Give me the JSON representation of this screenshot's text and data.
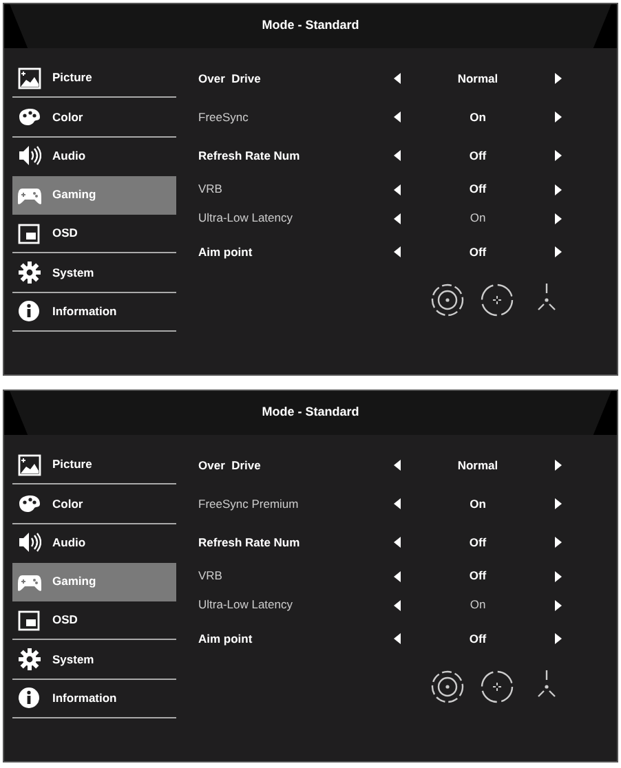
{
  "panels": [
    {
      "title": "Mode - Standard",
      "menu": [
        {
          "label": "Picture",
          "selected": false
        },
        {
          "label": "Color",
          "selected": false
        },
        {
          "label": "Audio",
          "selected": false
        },
        {
          "label": "Gaming",
          "selected": true
        },
        {
          "label": "OSD",
          "selected": false
        },
        {
          "label": "System",
          "selected": false
        },
        {
          "label": "Information",
          "selected": false
        }
      ],
      "settings": [
        {
          "label": "Over  Drive",
          "value": "Normal",
          "emphasized": true,
          "value_emphasized": true
        },
        {
          "label": "FreeSync",
          "value": "On",
          "emphasized": false,
          "value_emphasized": true
        },
        {
          "label": "Refresh Rate Num",
          "value": "Off",
          "emphasized": true,
          "value_emphasized": true
        },
        {
          "label": "VRB",
          "value": "Off",
          "emphasized": false,
          "value_emphasized": true
        },
        {
          "label": "Ultra-Low Latency",
          "value": "On",
          "emphasized": false,
          "value_emphasized": false
        },
        {
          "label": "Aim point",
          "value": "Off",
          "emphasized": true,
          "value_emphasized": true
        }
      ]
    },
    {
      "title": "Mode - Standard",
      "menu": [
        {
          "label": "Picture",
          "selected": false
        },
        {
          "label": "Color",
          "selected": false
        },
        {
          "label": "Audio",
          "selected": false
        },
        {
          "label": "Gaming",
          "selected": true
        },
        {
          "label": "OSD",
          "selected": false
        },
        {
          "label": "System",
          "selected": false
        },
        {
          "label": "Information",
          "selected": false
        }
      ],
      "settings": [
        {
          "label": "Over  Drive",
          "value": "Normal",
          "emphasized": true,
          "value_emphasized": true
        },
        {
          "label": "FreeSync Premium",
          "value": "On",
          "emphasized": false,
          "value_emphasized": true
        },
        {
          "label": "Refresh Rate Num",
          "value": "Off",
          "emphasized": true,
          "value_emphasized": true
        },
        {
          "label": "VRB",
          "value": "Off",
          "emphasized": false,
          "value_emphasized": true
        },
        {
          "label": "Ultra-Low Latency",
          "value": "On",
          "emphasized": false,
          "value_emphasized": false
        },
        {
          "label": "Aim point",
          "value": "Off",
          "emphasized": true,
          "value_emphasized": true
        }
      ]
    }
  ]
}
